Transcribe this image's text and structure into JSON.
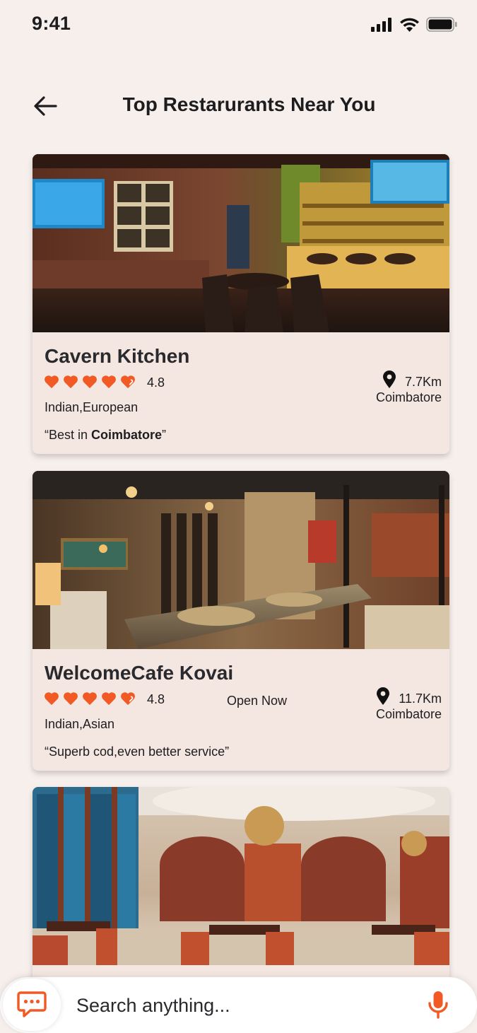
{
  "status_bar": {
    "time": "9:41"
  },
  "header": {
    "title": "Top Restarurants Near You",
    "back_icon": "arrow-left-icon"
  },
  "colors": {
    "accent": "#f15a24",
    "background": "#f7efec",
    "card": "#f4e7e2"
  },
  "restaurants": [
    {
      "name": "Cavern Kitchen",
      "rating": "4.8",
      "hearts": 4.5,
      "cuisine": "Indian,European",
      "review_prefix": "“Best in ",
      "review_bold": "Coimbatore",
      "review_suffix": "”",
      "distance": "7.7Km",
      "city": "Coimbatore",
      "status": ""
    },
    {
      "name": "WelcomeCafe Kovai",
      "rating": "4.8",
      "hearts": 4.5,
      "cuisine": "Indian,Asian",
      "review_prefix": "“Superb cod,even better service”",
      "review_bold": "",
      "review_suffix": "",
      "distance": "11.7Km",
      "city": "Coimbatore",
      "status": "Open Now"
    },
    {
      "name": "",
      "rating": "",
      "cuisine": "",
      "distance": "",
      "city": ""
    }
  ],
  "search": {
    "placeholder": "Search anything...",
    "chat_icon": "chat-bubble-icon",
    "mic_icon": "microphone-icon"
  }
}
